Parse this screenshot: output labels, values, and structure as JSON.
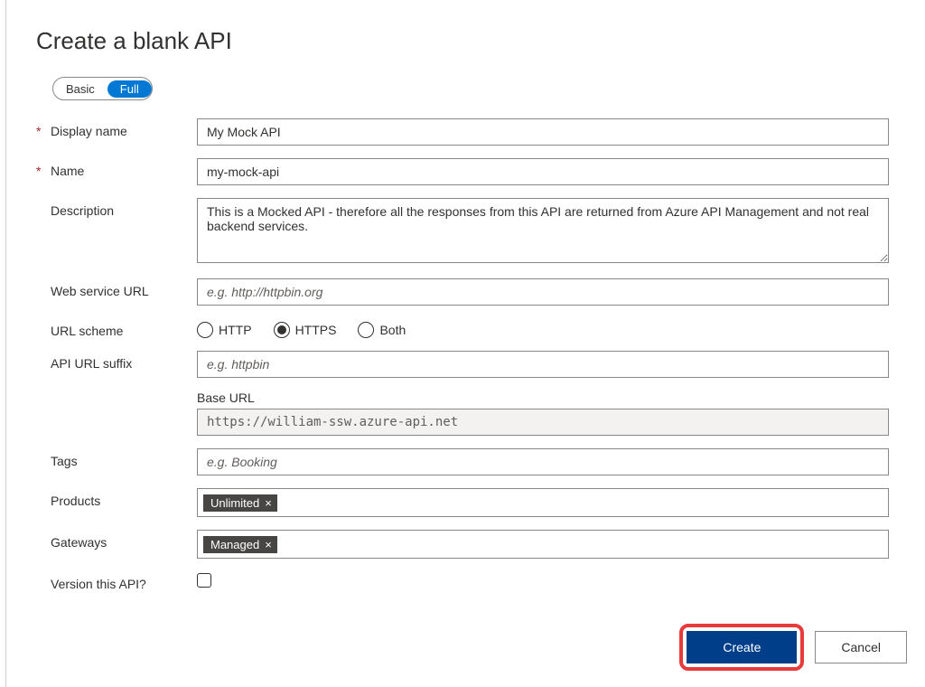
{
  "title": "Create a blank API",
  "toggle": {
    "basic": "Basic",
    "full": "Full",
    "active": "full"
  },
  "fields": {
    "displayName": {
      "label": "Display name",
      "value": "My Mock API",
      "required": true
    },
    "name": {
      "label": "Name",
      "value": "my-mock-api",
      "required": true
    },
    "description": {
      "label": "Description",
      "value": "This is a Mocked API - therefore all the responses from this API are returned from Azure API Management and not real backend services."
    },
    "webServiceUrl": {
      "label": "Web service URL",
      "placeholder": "e.g. http://httpbin.org"
    },
    "urlScheme": {
      "label": "URL scheme",
      "options": {
        "http": "HTTP",
        "https": "HTTPS",
        "both": "Both"
      },
      "selected": "https"
    },
    "apiUrlSuffix": {
      "label": "API URL suffix",
      "placeholder": "e.g. httpbin"
    },
    "baseUrl": {
      "label": "Base URL",
      "value": "https://william-ssw.azure-api.net"
    },
    "tags": {
      "label": "Tags",
      "placeholder": "e.g. Booking"
    },
    "products": {
      "label": "Products",
      "chips": [
        "Unlimited"
      ]
    },
    "gateways": {
      "label": "Gateways",
      "chips": [
        "Managed"
      ]
    },
    "versionApi": {
      "label": "Version this API?"
    }
  },
  "buttons": {
    "create": "Create",
    "cancel": "Cancel"
  }
}
